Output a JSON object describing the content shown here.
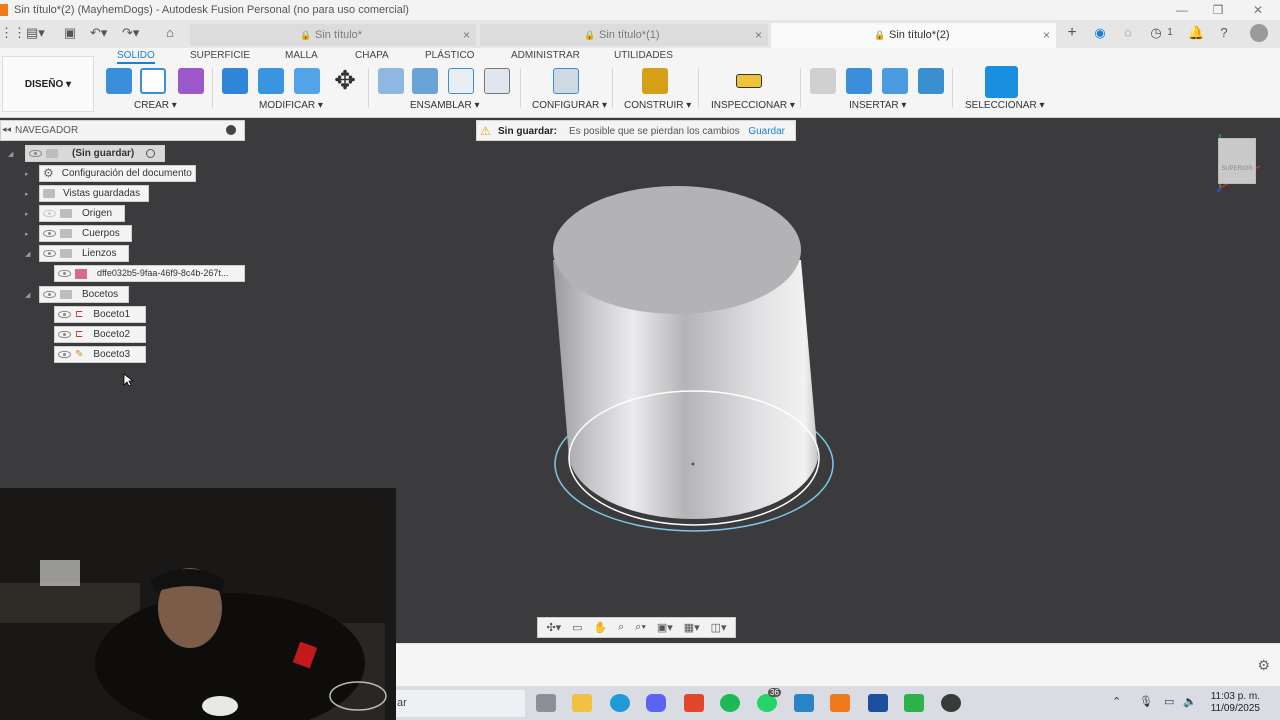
{
  "window": {
    "title": "Sin título*(2) (MayhemDogs) - Autodesk Fusion Personal (no para uso comercial)",
    "minimize_glyph": "—",
    "restore_glyph": "❐",
    "close_glyph": "✕"
  },
  "doc_tabs": [
    {
      "label": "Sin título*",
      "active": false
    },
    {
      "label": "Sin título*(1)",
      "active": false
    },
    {
      "label": "Sin título*(2)",
      "active": true
    }
  ],
  "quick_access": {
    "new_tab_glyph": "+",
    "notifications_count": "1"
  },
  "ribbon": {
    "workspace_label": "DISEÑO",
    "workspace_caret": "▾",
    "tabs": [
      "SOLIDO",
      "SUPERFICIE",
      "MALLA",
      "CHAPA",
      "PLÁSTICO",
      "ADMINISTRAR",
      "UTILIDADES"
    ],
    "active_tab": "SOLIDO",
    "groups": [
      {
        "label": "CREAR ▾"
      },
      {
        "label": "MODIFICAR ▾"
      },
      {
        "label": "ENSAMBLAR ▾"
      },
      {
        "label": "CONFIGURAR ▾"
      },
      {
        "label": "CONSTRUIR ▾"
      },
      {
        "label": "INSPECCIONAR ▾"
      },
      {
        "label": "INSERTAR ▾"
      },
      {
        "label": "SELECCIONAR ▾"
      }
    ]
  },
  "navigator": {
    "title": "NAVEGADOR",
    "root": "(Sin guardar)",
    "items": [
      {
        "label": "Configuración del documento",
        "icon": "gear-icon"
      },
      {
        "label": "Vistas guardadas",
        "icon": "folder-icon"
      },
      {
        "label": "Origen",
        "icon": "folder-icon"
      },
      {
        "label": "Cuerpos",
        "icon": "folder-icon"
      },
      {
        "label": "Lienzos",
        "icon": "folder-icon"
      },
      {
        "label": "dffe032b5-9faa-46f9-8c4b-267t...",
        "icon": "canvas-image-icon"
      },
      {
        "label": "Bocetos",
        "icon": "folder-icon"
      },
      {
        "label": "Boceto1",
        "icon": "sketch-icon"
      },
      {
        "label": "Boceto2",
        "icon": "sketch-icon"
      },
      {
        "label": "Boceto3",
        "icon": "sketch-icon"
      }
    ]
  },
  "warning": {
    "icon": "⚠",
    "bold": "Sin guardar:",
    "message": "Es posible que se pierdan los cambios",
    "action": "Guardar"
  },
  "viewcube": {
    "face": "SUPERIOR"
  },
  "taskbar": {
    "search_text": "ar",
    "notification_badge": "36",
    "time": "11:03 p. m.",
    "date": "11/09/2025"
  },
  "colors": {
    "accent": "#1a7fd8",
    "canvas": "#3b3b3d",
    "warning": "#e3a224",
    "brand": "#f07a1a"
  }
}
